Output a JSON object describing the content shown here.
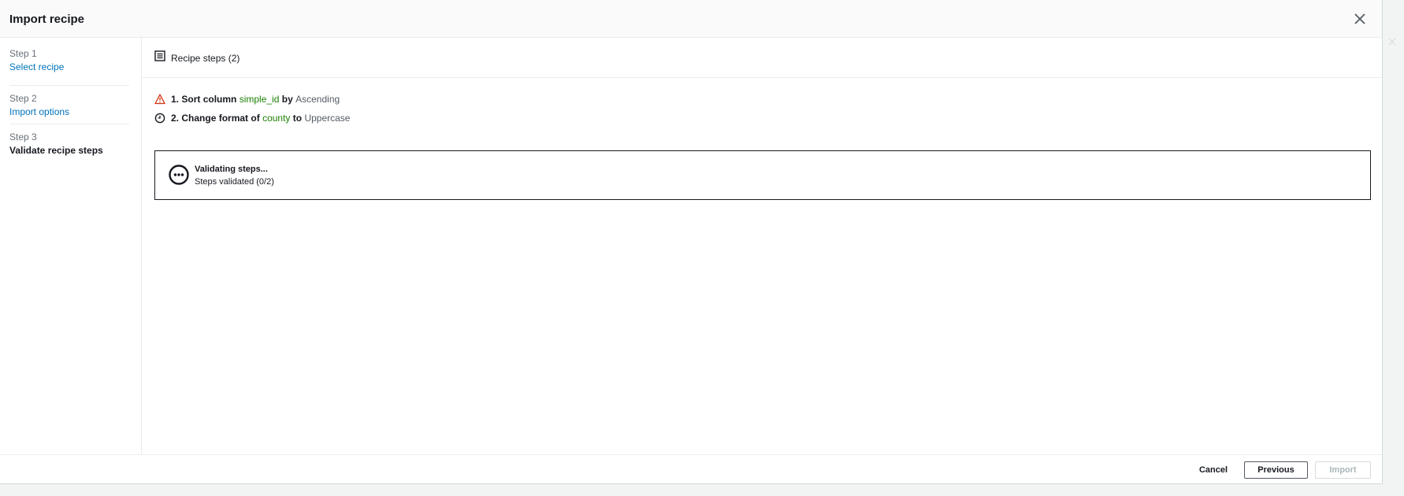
{
  "modal": {
    "title": "Import recipe"
  },
  "steps": [
    {
      "number": "Step 1",
      "name": "Select recipe",
      "state": "link"
    },
    {
      "number": "Step 2",
      "name": "Import options",
      "state": "link"
    },
    {
      "number": "Step 3",
      "name": "Validate recipe steps",
      "state": "current"
    }
  ],
  "section": {
    "title": "Recipe steps (2)",
    "icon": "list-icon"
  },
  "recipe_steps": [
    {
      "index": "1.",
      "action": "Sort column",
      "column": "simple_id",
      "connector": "by",
      "value": "Ascending",
      "icon": "warning-icon",
      "icon_color": "#d13212"
    },
    {
      "index": "2.",
      "action": "Change format",
      "connector1": "of",
      "column": "county",
      "connector": "to",
      "value": "Uppercase",
      "icon": "clock-icon",
      "icon_color": "#16191f"
    }
  ],
  "validation": {
    "title": "Validating steps...",
    "status": "Steps validated (0/2)",
    "icon": "in-progress-icon"
  },
  "footer": {
    "cancel_label": "Cancel",
    "previous_label": "Previous",
    "import_label": "Import"
  },
  "colors": {
    "link": "#0073bb",
    "column_name": "#1d8102",
    "value": "#545b64",
    "disabled": "#aab7b8"
  }
}
